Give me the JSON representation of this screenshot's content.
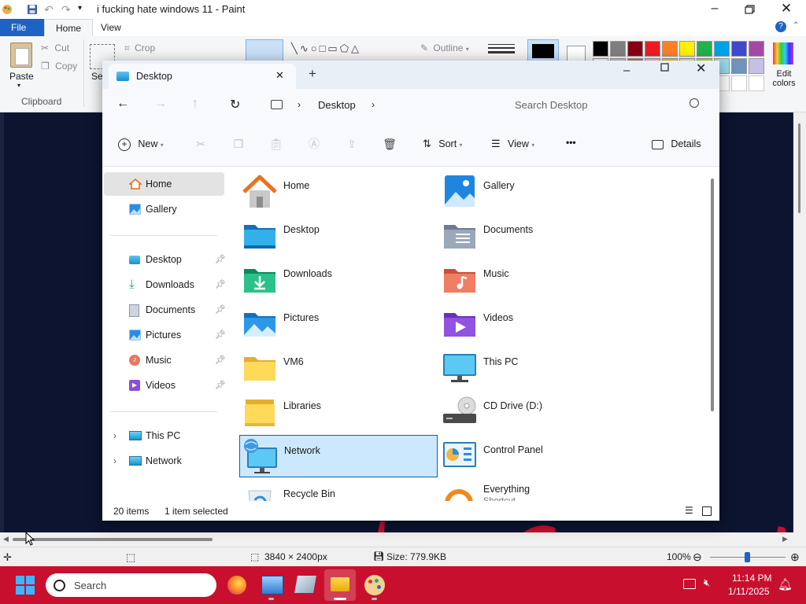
{
  "paint": {
    "title": "i fucking hate windows 11 - Paint",
    "tabs": [
      "File",
      "Home",
      "View"
    ],
    "clipboard": {
      "paste": "Paste",
      "cut": "Cut",
      "copy": "Copy",
      "group": "Clipboard",
      "select_partial": "Sel"
    },
    "image_group": {
      "crop": "Crop"
    },
    "shapes_group": {
      "outline": "Outline"
    },
    "edit_colors": "Edit colors",
    "palette": [
      "#000000",
      "#7f7f7f",
      "#880015",
      "#ed1c24",
      "#ff7f27",
      "#fff200",
      "#22b14c",
      "#00a2e8",
      "#3f48cc",
      "#a349a4",
      "#ffffff",
      "#c3c3c3",
      "#b97a57",
      "#ffaec9",
      "#ffc90e",
      "#efe4b0",
      "#b5e61d",
      "#99d9ea",
      "#7092be",
      "#c8bfe7"
    ],
    "status": {
      "dimensions": "3840 × 2400px",
      "size": "Size: 779.9KB",
      "zoom": "100%"
    }
  },
  "explorer": {
    "tab_title": "Desktop",
    "breadcrumb": [
      "Desktop"
    ],
    "search_placeholder": "Search Desktop",
    "commands": {
      "new": "New",
      "sort": "Sort",
      "view": "View",
      "more": "•••",
      "details": "Details"
    },
    "nav": {
      "top": [
        {
          "label": "Home"
        },
        {
          "label": "Gallery"
        }
      ],
      "quick": [
        {
          "label": "Desktop"
        },
        {
          "label": "Downloads"
        },
        {
          "label": "Documents"
        },
        {
          "label": "Pictures"
        },
        {
          "label": "Music"
        },
        {
          "label": "Videos"
        }
      ],
      "bottom": [
        {
          "label": "This PC"
        },
        {
          "label": "Network"
        }
      ]
    },
    "items": [
      {
        "name": "Home",
        "icon": "home-icon"
      },
      {
        "name": "Gallery",
        "icon": "gallery-icon"
      },
      {
        "name": "Desktop",
        "icon": "desktop-folder-icon"
      },
      {
        "name": "Documents",
        "icon": "documents-folder-icon"
      },
      {
        "name": "Downloads",
        "icon": "downloads-folder-icon"
      },
      {
        "name": "Music",
        "icon": "music-folder-icon"
      },
      {
        "name": "Pictures",
        "icon": "pictures-folder-icon"
      },
      {
        "name": "Videos",
        "icon": "videos-folder-icon"
      },
      {
        "name": "VM6",
        "icon": "folder-icon"
      },
      {
        "name": "This PC",
        "icon": "this-pc-icon"
      },
      {
        "name": "Libraries",
        "icon": "libraries-icon"
      },
      {
        "name": "CD Drive (D:)",
        "icon": "cd-drive-icon"
      },
      {
        "name": "Network",
        "icon": "network-icon",
        "selected": true
      },
      {
        "name": "Control Panel",
        "icon": "control-panel-icon"
      },
      {
        "name": "Recycle Bin",
        "icon": "recycle-bin-icon"
      },
      {
        "name": "Everything",
        "sub": "Shortcut",
        "icon": "everything-icon"
      }
    ],
    "status": {
      "count": "20 items",
      "selected": "1 item selected"
    }
  },
  "taskbar": {
    "search_placeholder": "Search",
    "time": "11:14 PM",
    "date": "1/11/2025"
  },
  "colors": {
    "taskbar": "#c8102e",
    "accent": "#0067c0",
    "selection": "#cce8ff"
  }
}
